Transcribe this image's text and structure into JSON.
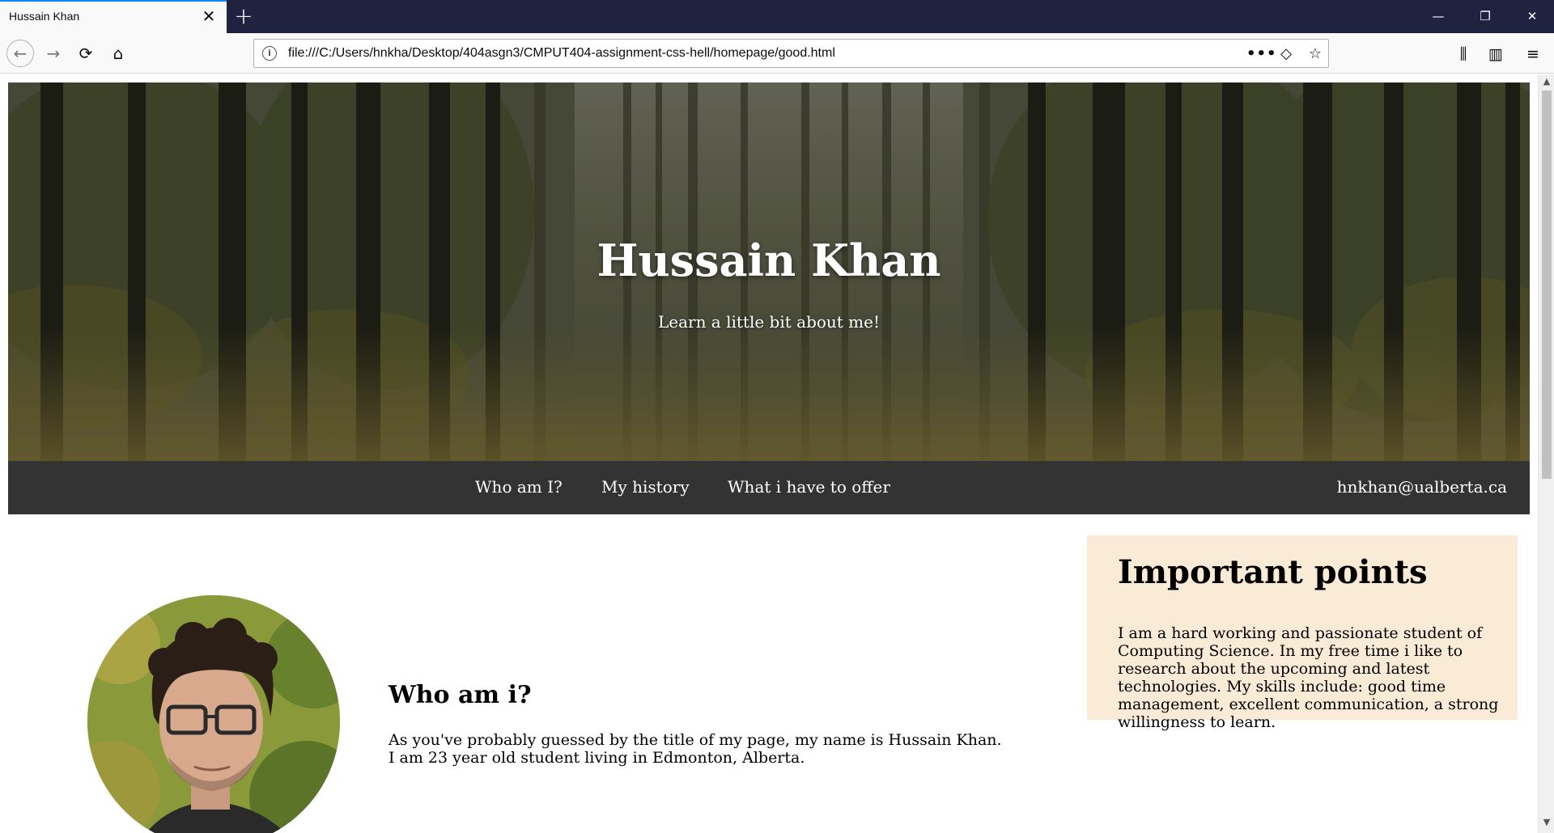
{
  "browser": {
    "tab_title": "Hussain Khan",
    "tab_close": "✕",
    "new_tab": "+",
    "url": "file:///C:/Users/hnkha/Desktop/404asgn3/CMPUT404-assignment-css-hell/homepage/good.html",
    "window_controls": {
      "minimize": "—",
      "restore": "❐",
      "close": "✕"
    },
    "icons": {
      "back": "←",
      "forward": "→",
      "reload": "⟳",
      "home": "⌂",
      "info": "i",
      "more": "•••",
      "pocket": "◇",
      "star": "☆",
      "library": "⫼",
      "sidebar": "▥",
      "menu": "≡",
      "scroll_up": "▲",
      "scroll_down": "▼"
    }
  },
  "hero": {
    "title": "Hussain Khan",
    "subtitle": "Learn a little bit about me!"
  },
  "nav": {
    "links": [
      "Who am I?",
      "My history",
      "What i have to offer"
    ],
    "email": "hnkhan@ualberta.ca"
  },
  "who": {
    "heading": "Who am i?",
    "text": "As you've probably guessed by the title of my page, my name is Hussain Khan. I am 23 year old student living in Edmonton, Alberta."
  },
  "aside": {
    "heading": "Important points",
    "text": "I am a hard working and passionate student of Computing Science. In my free time i like to research about the upcoming and latest technologies. My skills include: good time management, excellent communication, a strong willingness to learn."
  },
  "colors": {
    "tab_bar": "#202340",
    "nav_bg": "#333333",
    "aside_bg": "#faebd7",
    "active_tab_line": "#0a84ff"
  }
}
